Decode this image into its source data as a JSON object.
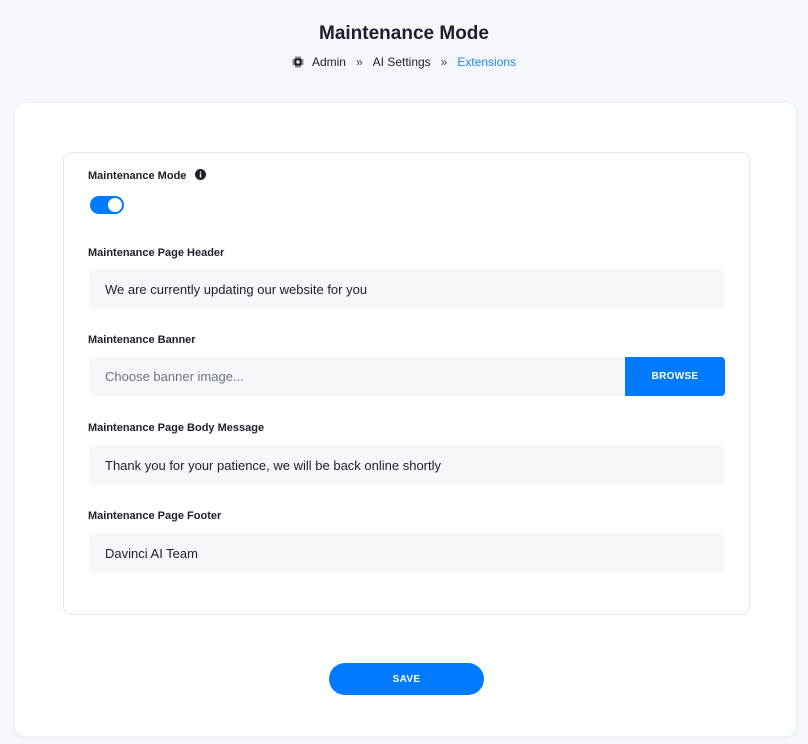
{
  "header": {
    "title": "Maintenance Mode",
    "breadcrumb": {
      "icon": "chip-icon",
      "items": [
        "Admin",
        "AI Settings",
        "Extensions"
      ],
      "separator": "»"
    }
  },
  "form": {
    "maintenance_mode": {
      "label": "Maintenance Mode",
      "icon": "info-icon",
      "enabled": true
    },
    "page_header": {
      "label": "Maintenance Page Header",
      "value": "We are currently updating our website for you"
    },
    "banner": {
      "label": "Maintenance Banner",
      "placeholder": "Choose banner image...",
      "browse_label": "BROWSE"
    },
    "body_message": {
      "label": "Maintenance Page Body Message",
      "value": "Thank you for your patience, we will be back online shortly"
    },
    "footer": {
      "label": "Maintenance Page Footer",
      "value": "Davinci AI Team"
    },
    "save_label": "SAVE"
  },
  "colors": {
    "accent": "#007bff",
    "breadcrumb_active": "#1e88e5",
    "background": "#f4f7fb",
    "field_bg": "#f5f7fa"
  }
}
